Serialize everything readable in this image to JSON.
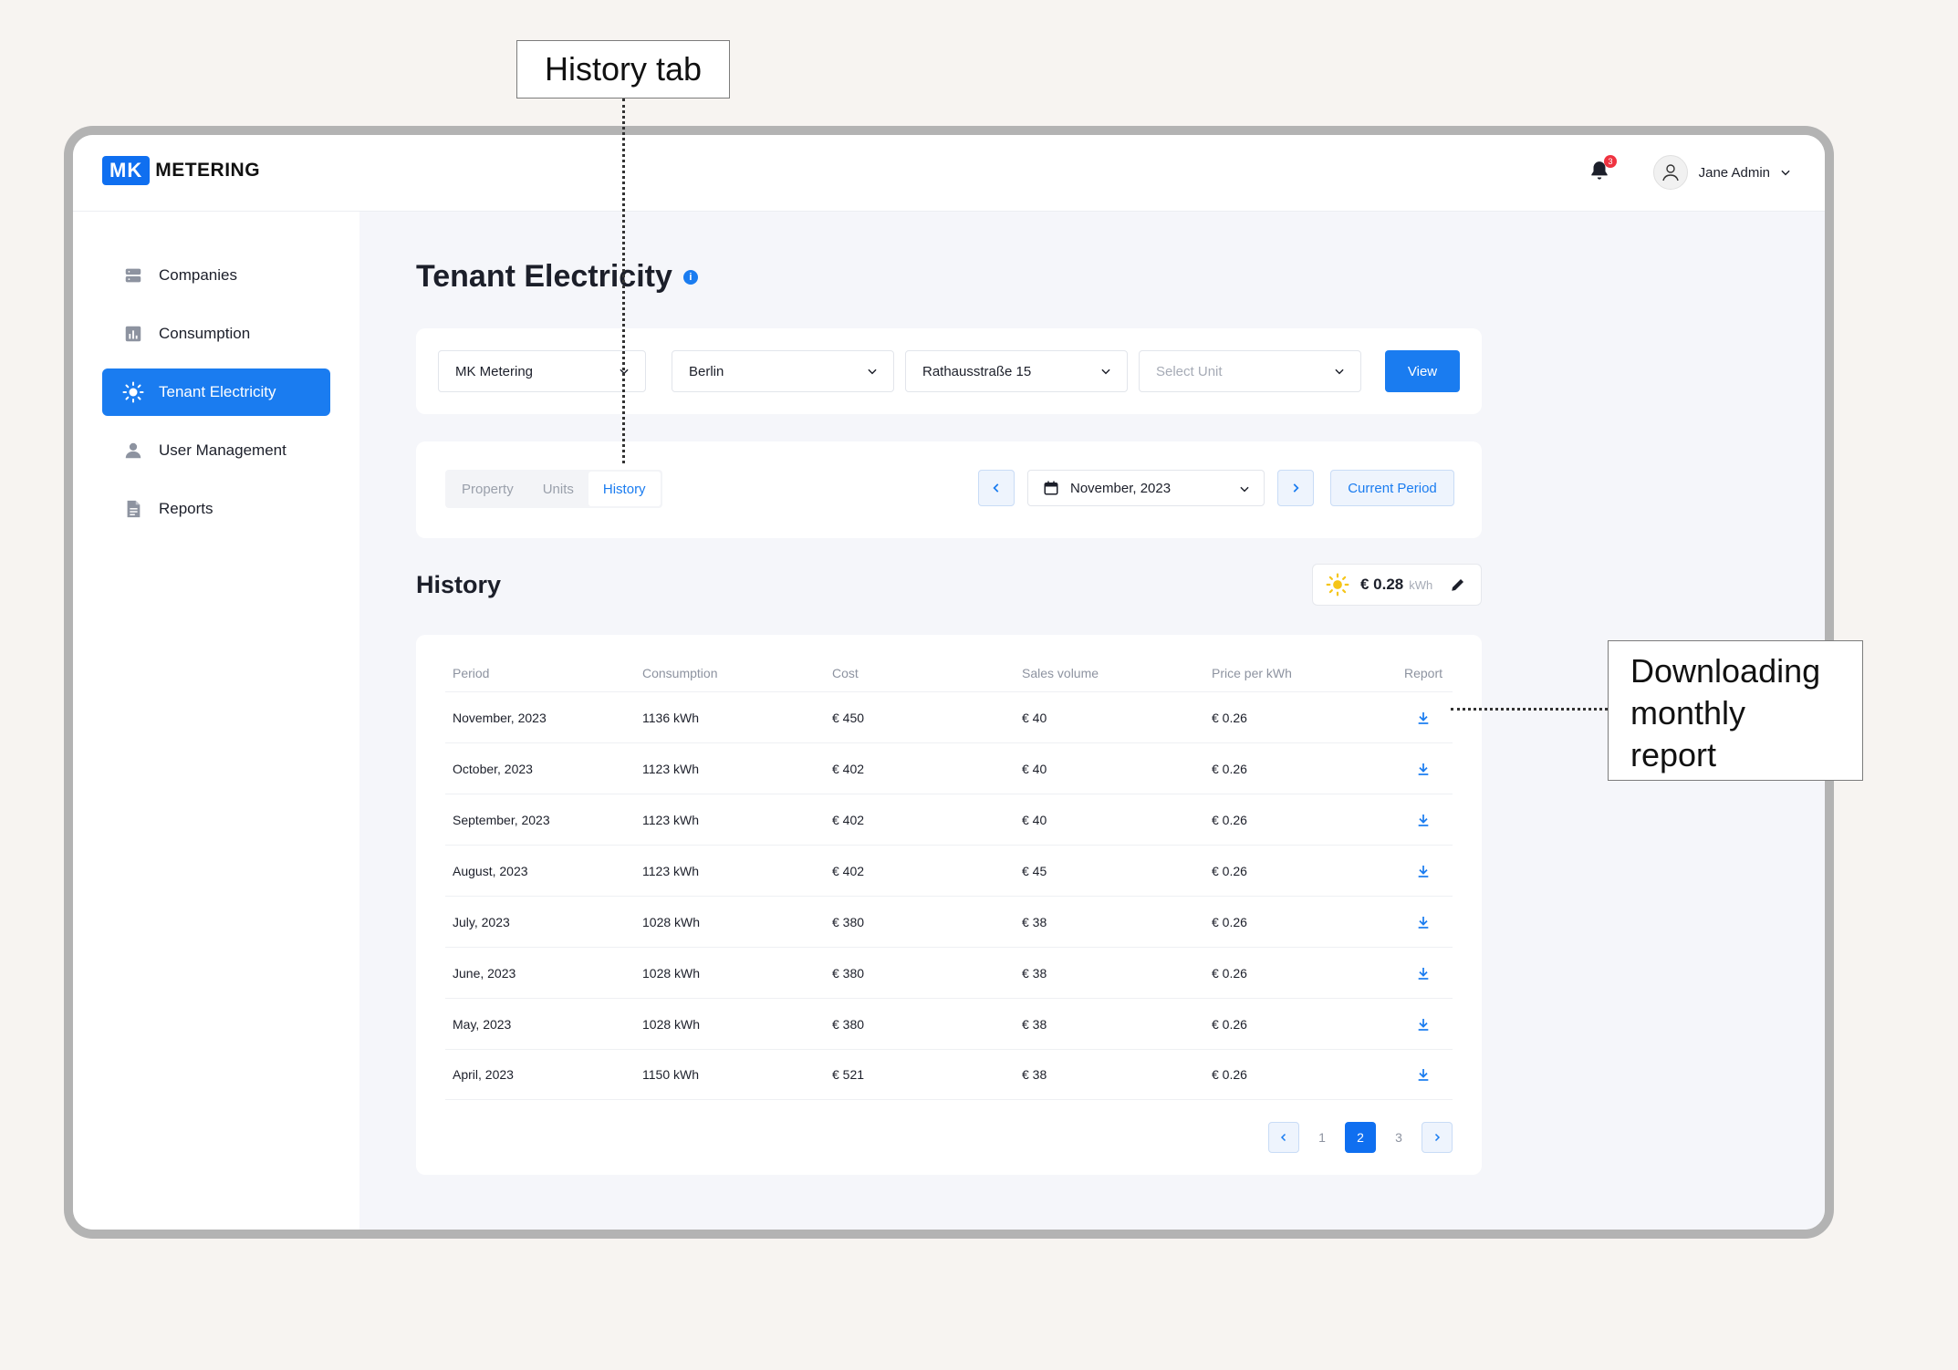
{
  "app": {
    "logo_mark": "MK",
    "logo_text": "METERING",
    "notification_count": "3",
    "user_name": "Jane Admin"
  },
  "sidebar": {
    "items": [
      {
        "label": "Companies",
        "icon": "server-icon"
      },
      {
        "label": "Consumption",
        "icon": "bar-chart-icon"
      },
      {
        "label": "Tenant Electricity",
        "icon": "sun-icon",
        "active": true
      },
      {
        "label": "User Management",
        "icon": "user-icon"
      },
      {
        "label": "Reports",
        "icon": "document-icon"
      }
    ]
  },
  "page": {
    "title": "Tenant Electricity",
    "info_icon": "i"
  },
  "filters": {
    "company": "MK Metering",
    "city": "Berlin",
    "address": "Rathausstraße 15",
    "unit_placeholder": "Select Unit",
    "view_label": "View"
  },
  "tabs": {
    "items": [
      "Property",
      "Units",
      "History"
    ],
    "active": "History"
  },
  "period": {
    "value": "November, 2023",
    "current_label": "Current Period"
  },
  "history": {
    "title": "History",
    "price_value": "€ 0.28",
    "price_unit": "kWh",
    "columns": [
      "Period",
      "Consumption",
      "Cost",
      "Sales volume",
      "Price per kWh",
      "Report"
    ],
    "rows": [
      {
        "period": "November, 2023",
        "consumption": "1136 kWh",
        "cost": "€ 450",
        "sales": "€ 40",
        "price": "€ 0.26"
      },
      {
        "period": "October, 2023",
        "consumption": "1123 kWh",
        "cost": "€ 402",
        "sales": "€ 40",
        "price": "€ 0.26"
      },
      {
        "period": "September, 2023",
        "consumption": "1123 kWh",
        "cost": "€ 402",
        "sales": "€ 40",
        "price": "€ 0.26"
      },
      {
        "period": "August, 2023",
        "consumption": "1123 kWh",
        "cost": "€ 402",
        "sales": "€ 45",
        "price": "€ 0.26"
      },
      {
        "period": "July, 2023",
        "consumption": "1028 kWh",
        "cost": "€ 380",
        "sales": "€ 38",
        "price": "€ 0.26"
      },
      {
        "period": "June, 2023",
        "consumption": "1028 kWh",
        "cost": "€ 380",
        "sales": "€ 38",
        "price": "€ 0.26"
      },
      {
        "period": "May, 2023",
        "consumption": "1028 kWh",
        "cost": "€ 380",
        "sales": "€ 38",
        "price": "€ 0.26"
      },
      {
        "period": "April, 2023",
        "consumption": "1150 kWh",
        "cost": "€ 521",
        "sales": "€ 38",
        "price": "€ 0.26"
      }
    ],
    "pages": [
      "1",
      "2",
      "3"
    ],
    "active_page": "2"
  },
  "annotations": {
    "history_tab": "History tab",
    "download_report": "Downloading monthly report"
  },
  "colors": {
    "accent": "#1a7cf0",
    "brand": "#0f6ff0",
    "badge": "#ef3340",
    "sun": "#f5c518"
  }
}
